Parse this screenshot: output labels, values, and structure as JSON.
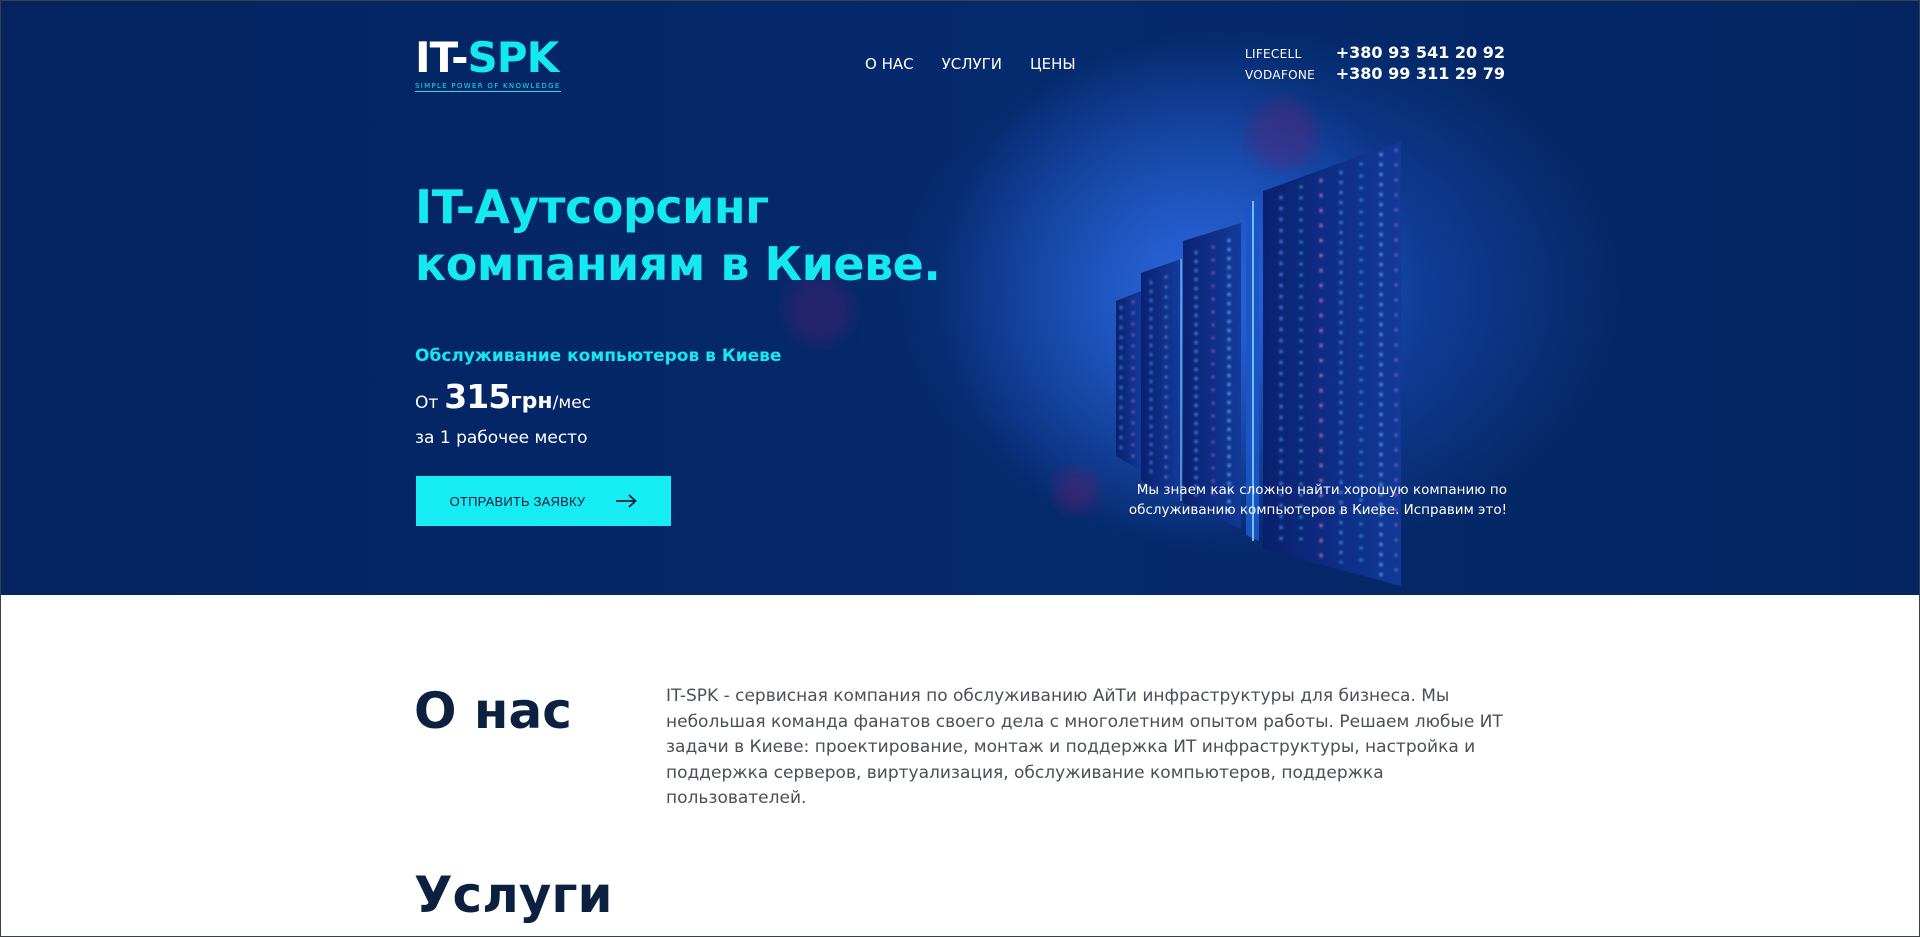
{
  "logo": {
    "it": "IT-",
    "spk": "SPK",
    "tagline": "SIMPLE POWER OF KNOWLEDGE"
  },
  "nav": [
    {
      "label": "О НАС"
    },
    {
      "label": "УСЛУГИ"
    },
    {
      "label": "ЦЕНЫ"
    }
  ],
  "phones": [
    {
      "carrier": "LIFECELL",
      "number": "+380 93 541 20 92"
    },
    {
      "carrier": "VODAFONE",
      "number": "+380 99 311 29 79"
    }
  ],
  "hero": {
    "headline_line1": "IT-Аутсорсинг",
    "headline_line2": "компаниям в Киеве.",
    "subtitle": "Обслуживание компьютеров в Киеве",
    "price_from": "От",
    "price_value": "315",
    "price_currency": "грн",
    "price_period": "/мес",
    "workplace": "за 1 рабочее место",
    "cta_label": "ОТПРАВИТЬ ЗАЯВКУ",
    "tagline": "Мы знаем как сложно найти хорошую компанию по обслуживанию компьютеров в Киеве. Исправим это!"
  },
  "about": {
    "title": "О нас",
    "text": "IT-SPK - сервисная компания по обслуживанию АйТи инфраструктуры для бизнеса. Мы небольшая команда фанатов своего дела с многолетним опытом работы. Решаем любые ИТ задачи в Киеве: проектирование, монтаж и поддержка ИТ инфраструктуры, настройка и поддержка серверов, виртуализация, обслуживание компьютеров, поддержка пользователей."
  },
  "services": {
    "title": "Услуги"
  },
  "colors": {
    "hero_bg": "#04235f",
    "accent": "#14e8f0",
    "heading": "#0c2140",
    "body_text": "#4a4f59"
  }
}
